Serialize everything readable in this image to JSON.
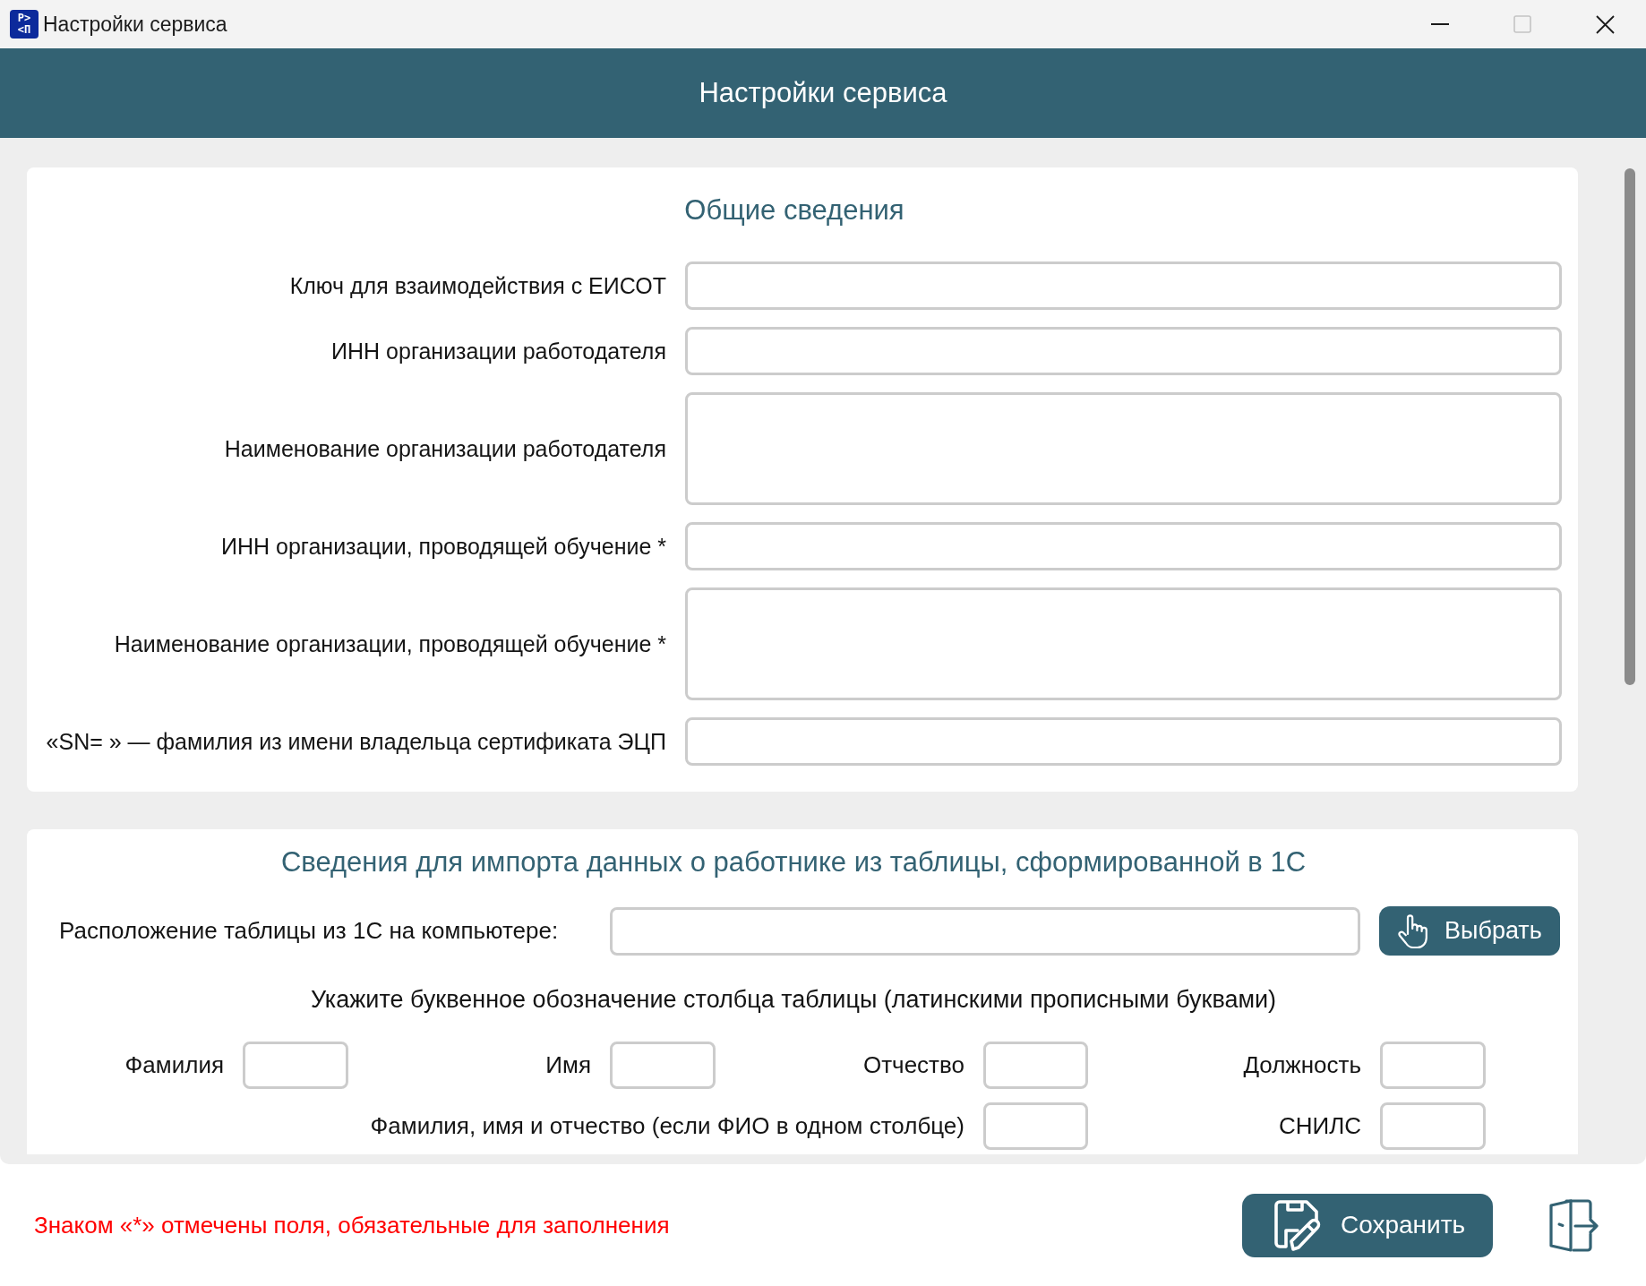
{
  "window": {
    "logo": [
      "P>",
      "<П"
    ],
    "title": "Настройки сервиса",
    "controls": [
      {
        "kind": "minimize",
        "disabled": false
      },
      {
        "kind": "maximize",
        "disabled": true
      },
      {
        "kind": "close",
        "disabled": false
      }
    ]
  },
  "header": {
    "title": "Настройки сервиса"
  },
  "general": {
    "heading": "Общие сведения",
    "fields": [
      {
        "label": "Ключ для взаимодействия с ЕИСОТ",
        "kind": "line"
      },
      {
        "label": "ИНН организации работодателя",
        "kind": "line"
      },
      {
        "label": "Наименование организации работодателя",
        "kind": "multiline"
      },
      {
        "label": "ИНН организации, проводящей обучение *",
        "kind": "line"
      },
      {
        "label": "Наименование организации, проводящей обучение *",
        "kind": "multiline"
      },
      {
        "label": "«SN= » — фамилия из имени владельца сертификата ЭЦП",
        "kind": "line"
      }
    ]
  },
  "import": {
    "heading": "Сведения для импорта данных о работнике из таблицы, сформированной в 1С",
    "file": {
      "label": "Расположение таблицы из 1С на компьютере:",
      "button": "Выбрать"
    },
    "instruction": "Укажите буквенное обозначение столбца таблицы (латинскими прописными буквами)",
    "column_rows": [
      [
        {
          "label": "Фамилия"
        },
        {
          "label": "Имя"
        },
        {
          "label": "Отчество"
        },
        {
          "label": "Должность"
        }
      ],
      [
        {
          "label": "Фамилия, имя и отчество (если ФИО в одном столбце)"
        },
        {
          "label": "СНИЛС"
        }
      ]
    ]
  },
  "footer": {
    "note": "Знаком «*» отмечены поля, обязательные для заполнения",
    "save_button": "Сохранить"
  }
}
